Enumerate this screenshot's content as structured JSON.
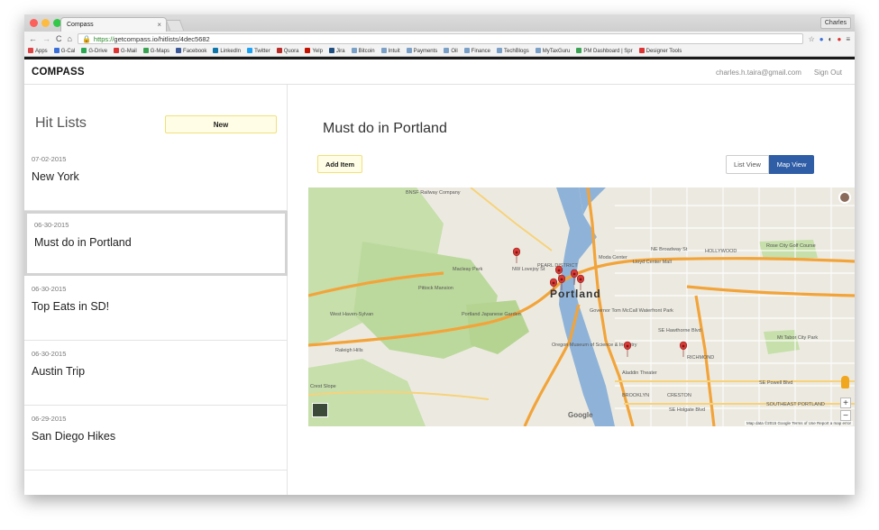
{
  "browser": {
    "tab_title": "Compass",
    "tab_close": "×",
    "user": "Charles",
    "url_scheme": "https://",
    "url_rest": "getcompass.io/hitlists/4dec5682",
    "nav": {
      "back": "←",
      "forward": "→",
      "reload": "C",
      "home": "⌂"
    },
    "bookmarks": [
      {
        "label": "Apps",
        "color": "#d44"
      },
      {
        "label": "G-Cal",
        "color": "#3a6fd8"
      },
      {
        "label": "G-Drive",
        "color": "#2aa851"
      },
      {
        "label": "G-Mail",
        "color": "#d33"
      },
      {
        "label": "G-Maps",
        "color": "#3aa353"
      },
      {
        "label": "Facebook",
        "color": "#3b5998"
      },
      {
        "label": "LinkedIn",
        "color": "#0e76a8"
      },
      {
        "label": "Twitter",
        "color": "#1da1f2"
      },
      {
        "label": "Quora",
        "color": "#b92b27"
      },
      {
        "label": "Yelp",
        "color": "#c41200"
      },
      {
        "label": "Jira",
        "color": "#205081"
      },
      {
        "label": "Bitcoin",
        "color": "#7aa0c8"
      },
      {
        "label": "Intuit",
        "color": "#7aa0c8"
      },
      {
        "label": "Payments",
        "color": "#7aa0c8"
      },
      {
        "label": "Oil",
        "color": "#7aa0c8"
      },
      {
        "label": "Finance",
        "color": "#7aa0c8"
      },
      {
        "label": "TechBlogs",
        "color": "#7aa0c8"
      },
      {
        "label": "MyTaxGuru",
        "color": "#7aa0c8"
      },
      {
        "label": "PM Dashboard | Spr",
        "color": "#3aa353"
      },
      {
        "label": "Designer Tools",
        "color": "#d33"
      }
    ]
  },
  "header": {
    "brand": "COMPASS",
    "email": "charles.h.taira@gmail.com",
    "signout": "Sign Out"
  },
  "sidebar": {
    "title": "Hit Lists",
    "new_label": "New",
    "items": [
      {
        "date": "07-02-2015",
        "name": "New York"
      },
      {
        "date": "06-30-2015",
        "name": "Must do in Portland"
      },
      {
        "date": "06-30-2015",
        "name": "Top Eats in SD!"
      },
      {
        "date": "06-30-2015",
        "name": "Austin Trip"
      },
      {
        "date": "06-29-2015",
        "name": "San Diego Hikes"
      }
    ],
    "selected_index": 1
  },
  "main": {
    "title": "Must do in Portland",
    "add_label": "Add Item",
    "list_view_label": "List View",
    "map_view_label": "Map View",
    "active_view": "Map View"
  },
  "map": {
    "city_label": "Portland",
    "attribution": "Map data ©2015 Google   Terms of Use   Report a map error",
    "logo": "Google",
    "zoom_in": "+",
    "zoom_out": "−",
    "labels": [
      "BNSF Railway Company",
      "Moda Center",
      "Lloyd Center Mall",
      "Rose City Golf Course",
      "Macleay Park",
      "Pittock Mansion",
      "Portland Japanese Garden",
      "West Haven-Sylvan",
      "Oregon Museum of Science & Industry",
      "Aladdin Theater",
      "Mt Tabor City Park",
      "HOLLYWOOD",
      "RICHMOND",
      "Raleigh Hills",
      "Crest Slope",
      "NW Lovejoy St",
      "PEARL DISTRICT",
      "Governor Tom McCall Waterfront Park",
      "NE Broadway St",
      "SE Hawthorne Blvd",
      "SE Powell Blvd",
      "SE Holgate Blvd",
      "BROOKLYN",
      "CRESTON",
      "SOUTHEAST PORTLAND"
    ],
    "pins": 8
  },
  "colors": {
    "accent": "#2f5ea6",
    "button_bg": "#fffde5",
    "button_border": "#f1e07a",
    "pin": "#d93a36",
    "road": "#f2a43a",
    "river": "#8fb3d8",
    "park": "#c6dfab"
  }
}
